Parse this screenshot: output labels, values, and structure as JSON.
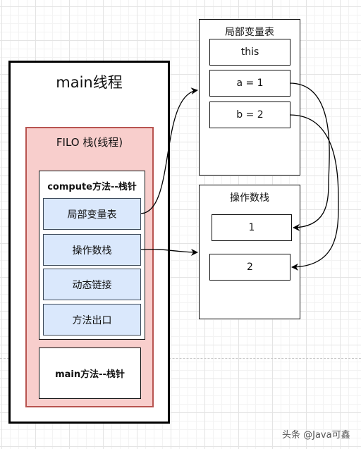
{
  "thread": {
    "title": "main线程"
  },
  "filo": {
    "title": "FILO  栈(线程)"
  },
  "compute_frame": {
    "title": "compute方法--栈针",
    "slots": [
      "局部变量表",
      "操作数栈",
      "动态链接",
      "方法出口"
    ]
  },
  "main_frame": {
    "title": "main方法--栈针"
  },
  "local_var_table": {
    "title": "局部变量表",
    "cells": [
      "this",
      "a = 1",
      "b = 2"
    ]
  },
  "operand_stack": {
    "title": "操作数栈",
    "cells": [
      "1",
      "2"
    ]
  },
  "colors": {
    "filo_fill": "#f8cecc",
    "filo_border": "#b85450",
    "slot_fill": "#dae8fc"
  },
  "watermark": "头条 @Java可鑫"
}
